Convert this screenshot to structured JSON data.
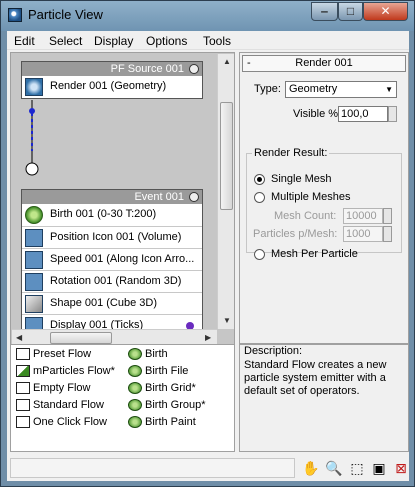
{
  "window": {
    "title": "Particle View"
  },
  "menu": [
    "Edit",
    "Select",
    "Display",
    "Options",
    "Tools"
  ],
  "graph": {
    "source": {
      "title": "PF Source 001",
      "operator": "Render 001 (Geometry)"
    },
    "event": {
      "title": "Event 001",
      "operators": [
        {
          "label": "Birth 001 (0-30 T:200)",
          "icon": "birth-icon"
        },
        {
          "label": "Position Icon 001 (Volume)",
          "icon": "position-icon"
        },
        {
          "label": "Speed 001 (Along Icon Arro...",
          "icon": "speed-icon"
        },
        {
          "label": "Rotation 001 (Random 3D)",
          "icon": "rotation-icon"
        },
        {
          "label": "Shape 001 (Cube 3D)",
          "icon": "shape-icon"
        },
        {
          "label": "Display 001 (Ticks)",
          "icon": "display-icon"
        }
      ]
    }
  },
  "depot": {
    "left": [
      "Preset Flow",
      "mParticles Flow*",
      "Empty Flow",
      "Standard Flow",
      "One Click Flow"
    ],
    "right": [
      "Birth",
      "Birth File",
      "Birth Grid*",
      "Birth Group*",
      "Birth Paint"
    ]
  },
  "panel": {
    "rollout_title": "Render 001",
    "collapse_symbol": "-",
    "type_label": "Type:",
    "type_value": "Geometry",
    "visible_label": "Visible %",
    "visible_value": "100,0",
    "render_result_label": "Render Result:",
    "single_mesh": "Single Mesh",
    "multiple_meshes": "Multiple Meshes",
    "mesh_count_label": "Mesh Count:",
    "mesh_count_value": "10000",
    "particles_per_mesh_label": "Particles p/Mesh:",
    "particles_per_mesh_value": "1000",
    "mesh_per_particle": "Mesh Per Particle",
    "selected_option": "single_mesh"
  },
  "description": {
    "label": "Description:",
    "text": "Standard Flow creates a new\nparticle system emitter with a\ndefault set of operators."
  },
  "colors": {
    "accent": "#6f94b2",
    "display_dot": "#6a2bbf"
  }
}
